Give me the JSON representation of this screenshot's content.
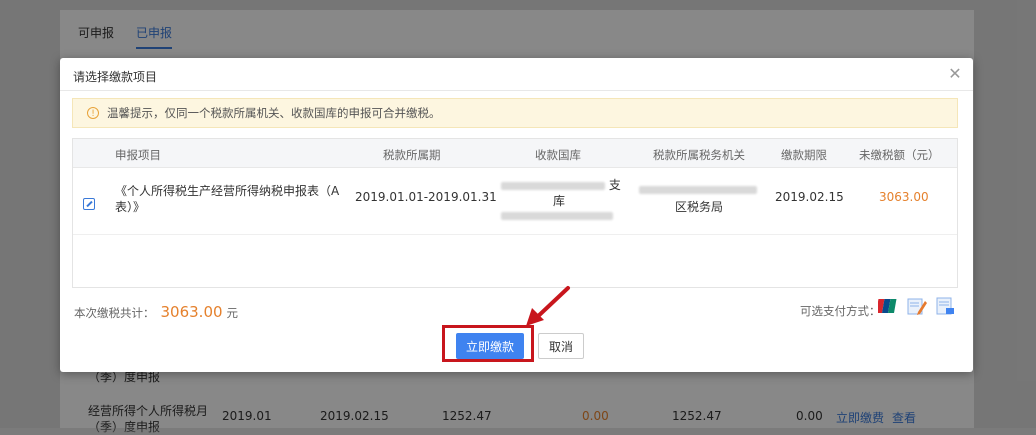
{
  "background": {
    "tabs": [
      {
        "label": "可申报"
      },
      {
        "label": "已申报"
      }
    ],
    "rows": [
      {
        "name_line1": "（季）度申报",
        "name_line2": ""
      },
      {
        "name_line1": "经营所得个人所得税月",
        "name_line2": "（季）度申报",
        "period": "2019.01",
        "deadline": "2019.02.15",
        "amount1": "1252.47",
        "amount2": "0.00",
        "amount3": "1252.47",
        "amount4": "0.00",
        "action_pay": "立即缴费",
        "action_view": "查看"
      }
    ]
  },
  "modal": {
    "title": "请选择缴款项目",
    "close_icon": "close-icon",
    "notice": "温馨提示，仅同一个税款所属机关、收款国库的申报可合并缴税。",
    "table": {
      "headers": {
        "item": "申报项目",
        "period": "税款所属期",
        "treasury": "收款国库",
        "authority": "税款所属税务机关",
        "deadline": "缴款期限",
        "unpaid": "未缴税额（元）"
      },
      "rows": [
        {
          "item_line1": "《个人所得税生产经营所得纳税申报表（A",
          "item_line2": "表）》",
          "period": "2019.01.01-2019.01.31",
          "treasury_suffix1": "支",
          "treasury_suffix2": "库",
          "authority_suffix": "区税务局",
          "deadline": "2019.02.15",
          "unpaid": "3063.00"
        }
      ]
    },
    "total_label": "本次缴税共计：",
    "total_value": "3063.00",
    "total_unit": "元",
    "pay_methods_label": "可选支付方式：",
    "pay_icons": [
      "unionpay-icon",
      "sign-pen-icon",
      "bank-transfer-icon"
    ],
    "btn_pay": "立即缴款",
    "btn_cancel": "取消"
  },
  "colors": {
    "accent": "#3f83f0",
    "amount": "#e5812d",
    "highlight": "#c8161d"
  }
}
